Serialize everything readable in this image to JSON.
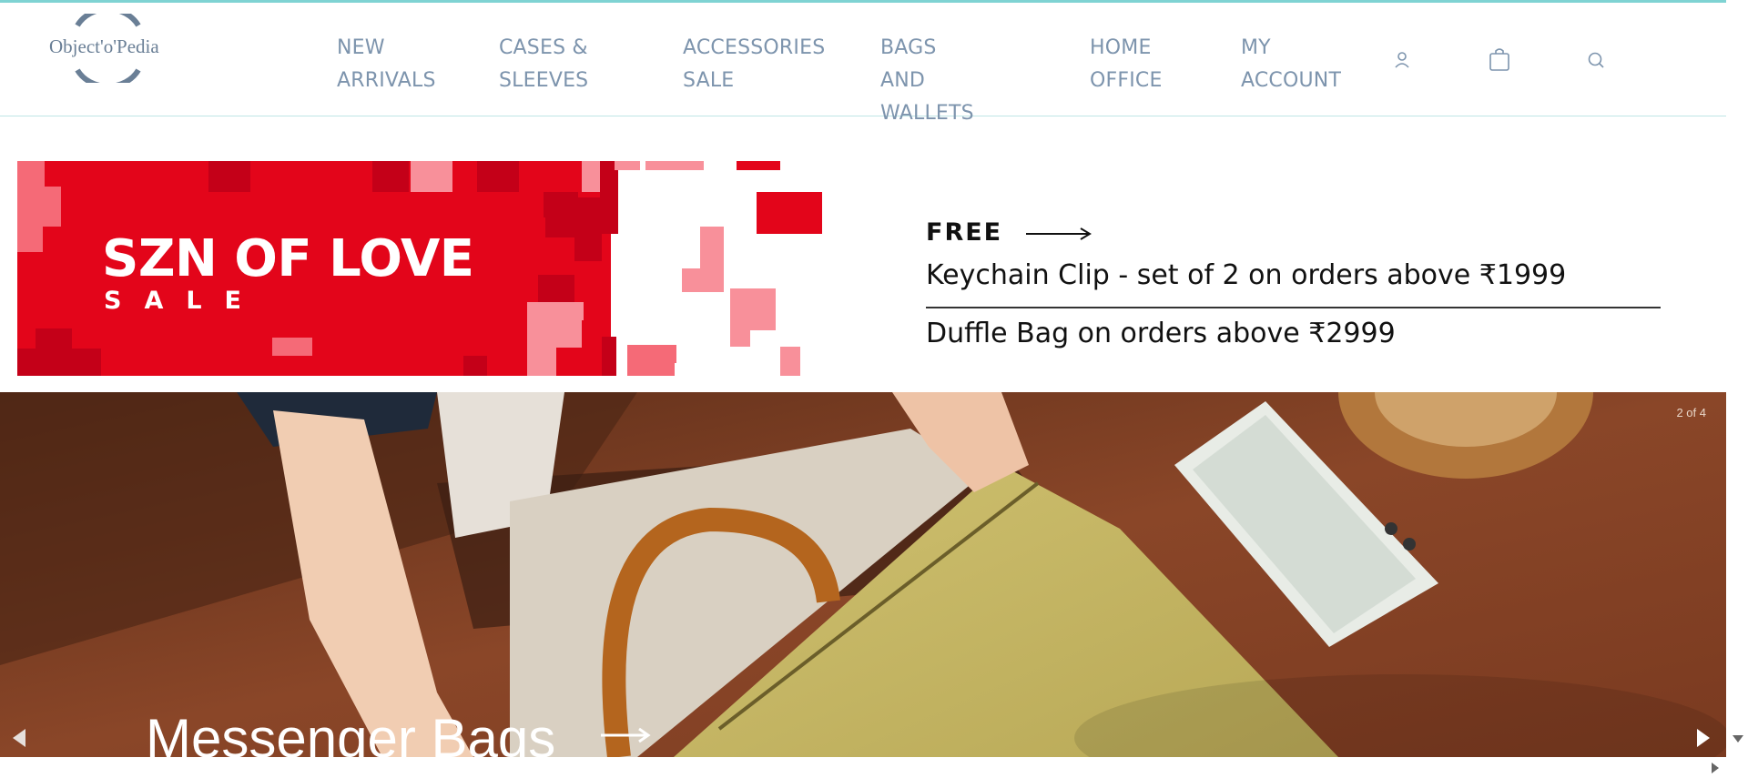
{
  "brand": {
    "name": "Object'o'Pedia",
    "accent": "#7fd3d3",
    "nav_color": "#7d94ad"
  },
  "nav": {
    "items": [
      {
        "label": "NEW\nARRIVALS"
      },
      {
        "label": "CASES &\nSLEEVES"
      },
      {
        "label": "ACCESSORIES\nSALE"
      },
      {
        "label": "BAGS AND\nWALLETS"
      },
      {
        "label": "HOME\nOFFICE"
      },
      {
        "label": "MY\nACCOUNT"
      }
    ],
    "icons": [
      "user-icon",
      "shopping-bag-icon",
      "search-icon"
    ]
  },
  "promo": {
    "title": "SZN OF LOVE",
    "subtitle": "SALE",
    "bg_color": "#e3051a"
  },
  "offer": {
    "free_label": "FREE",
    "line1": "Keychain Clip - set of 2 on orders above ₹1999",
    "line2": "Duffle Bag on orders above ₹2999"
  },
  "hero": {
    "title": "Messenger Bags",
    "slide_counter": "2 of 4",
    "prev_icon": "chevron-left-icon",
    "next_icon": "chevron-right-icon"
  }
}
